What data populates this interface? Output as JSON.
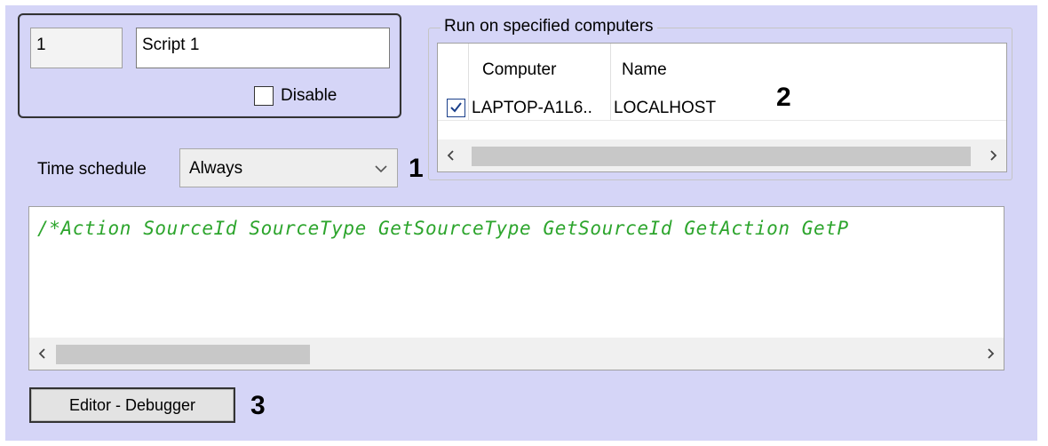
{
  "script": {
    "id_value": "1",
    "name_value": "Script 1",
    "disable_label": "Disable"
  },
  "schedule": {
    "label": "Time schedule",
    "selected": "Always"
  },
  "computers": {
    "group_title": "Run on specified computers",
    "columns": [
      "Computer",
      "Name"
    ],
    "rows": [
      {
        "checked": true,
        "computer": "LAPTOP-A1L6..",
        "name": "LOCALHOST"
      }
    ]
  },
  "editor": {
    "code_text": "/*Action SourceId SourceType GetSourceType GetSourceId GetAction GetP"
  },
  "buttons": {
    "editor_debugger": "Editor - Debugger"
  },
  "callouts": {
    "one": "1",
    "two": "2",
    "three": "3"
  },
  "icons": {
    "scroll_left": "chevron-left-icon",
    "scroll_right": "chevron-right-icon",
    "dropdown": "chevron-down-icon",
    "checkmark": "checkmark-icon"
  },
  "colors": {
    "panel_background": "#d5d5f7",
    "code_comment": "#2da52d",
    "checkbox_check": "#1a3f8a"
  }
}
